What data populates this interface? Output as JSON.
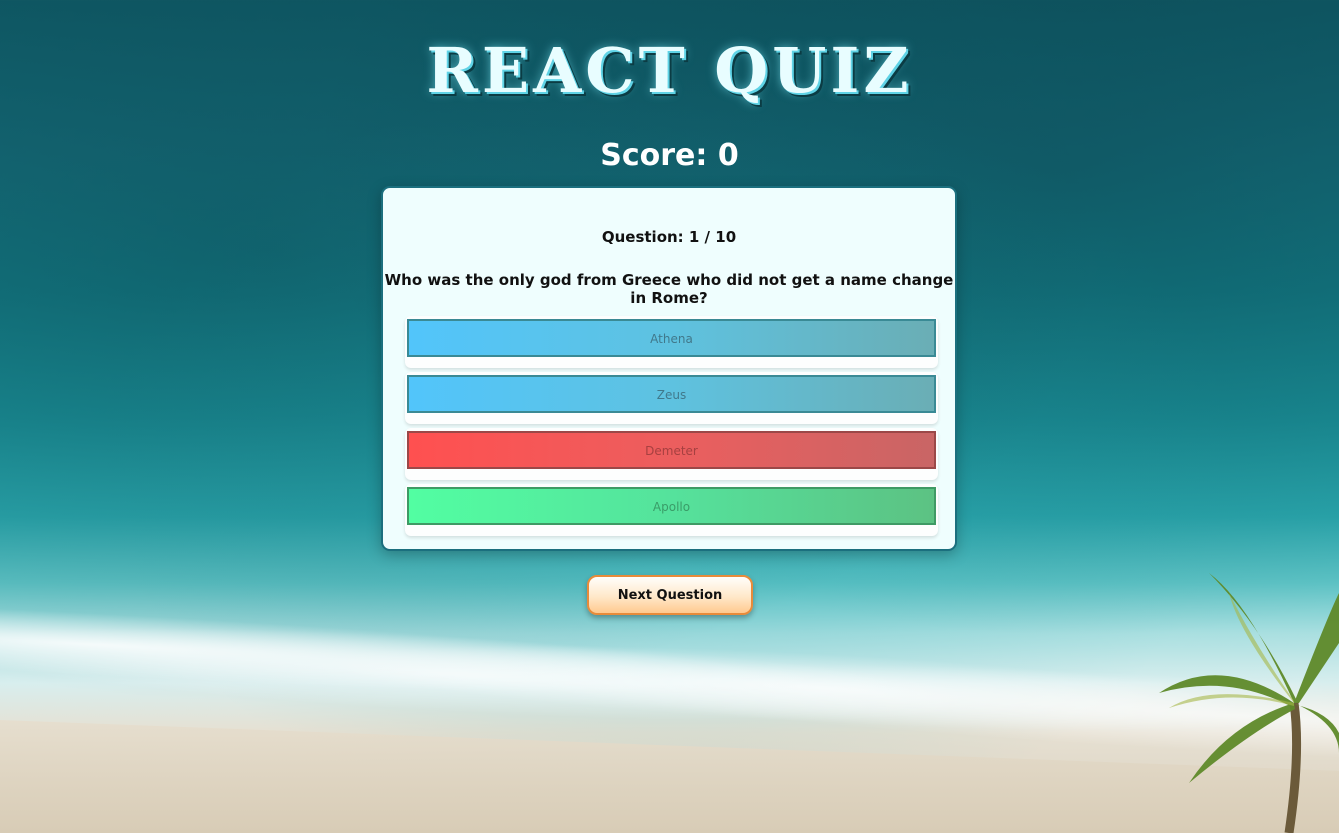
{
  "app": {
    "title": "REACT QUIZ",
    "score_label": "Score: 0"
  },
  "quiz": {
    "question_number": "Question: 1 / 10",
    "question_text": "Who was the only god from Greece who did not get a name change in Rome?",
    "answers": [
      {
        "label": "Athena",
        "state": "unselected"
      },
      {
        "label": "Zeus",
        "state": "unselected"
      },
      {
        "label": "Demeter",
        "state": "incorrect"
      },
      {
        "label": "Apollo",
        "state": "correct"
      }
    ]
  },
  "actions": {
    "next_label": "Next Question"
  },
  "colors": {
    "card_background": "#effefe",
    "card_border": "#1b6f7e",
    "answer_blue": "#52c5fb",
    "answer_red": "#ff5050",
    "answer_green": "#52fea2",
    "next_button_border": "#e88b3a"
  }
}
